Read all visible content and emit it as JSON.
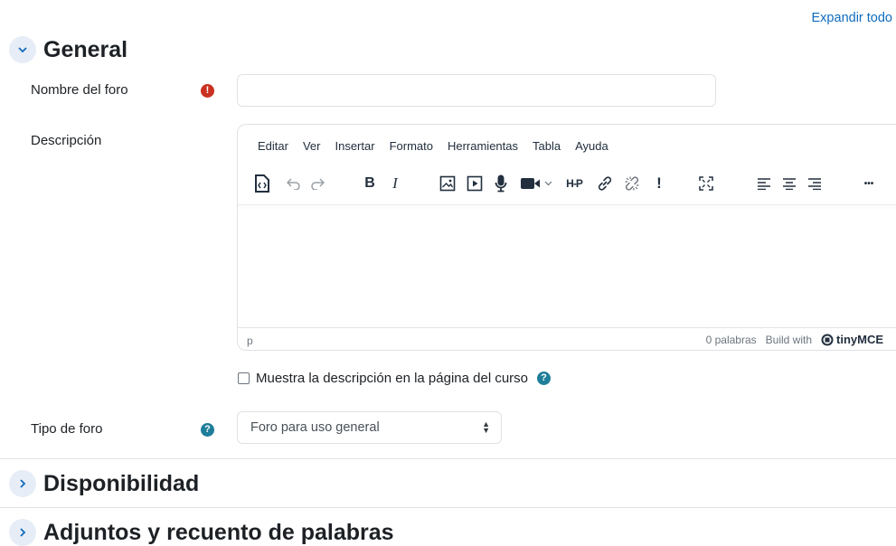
{
  "header": {
    "expand_all": "Expandir todo"
  },
  "sections": {
    "general": {
      "title": "General"
    },
    "availability": {
      "title": "Disponibilidad"
    },
    "attachments": {
      "title": "Adjuntos y recuento de palabras"
    }
  },
  "fields": {
    "forum_name": {
      "label": "Nombre del foro",
      "value": "",
      "required_icon": "exclamation-icon"
    },
    "description": {
      "label": "Descripción"
    },
    "show_description": {
      "label": "Muestra la descripción en la página del curso",
      "checked": false
    },
    "forum_type": {
      "label": "Tipo de foro",
      "selected": "Foro para uso general"
    }
  },
  "editor": {
    "menu": [
      "Editar",
      "Ver",
      "Insertar",
      "Formato",
      "Herramientas",
      "Tabla",
      "Ayuda"
    ],
    "toolbar_text": {
      "bold": "B",
      "italic": "I",
      "h5p": "H-P",
      "exclam": "!",
      "more": "•••"
    },
    "status": {
      "path": "p",
      "word_count": "0 palabras",
      "build_with": "Build with",
      "brand": "tinyMCE"
    }
  },
  "colors": {
    "link": "#0f6cbf",
    "required": "#ca3120",
    "help": "#1f7e9a",
    "chevron_bg": "#e7edf6"
  }
}
